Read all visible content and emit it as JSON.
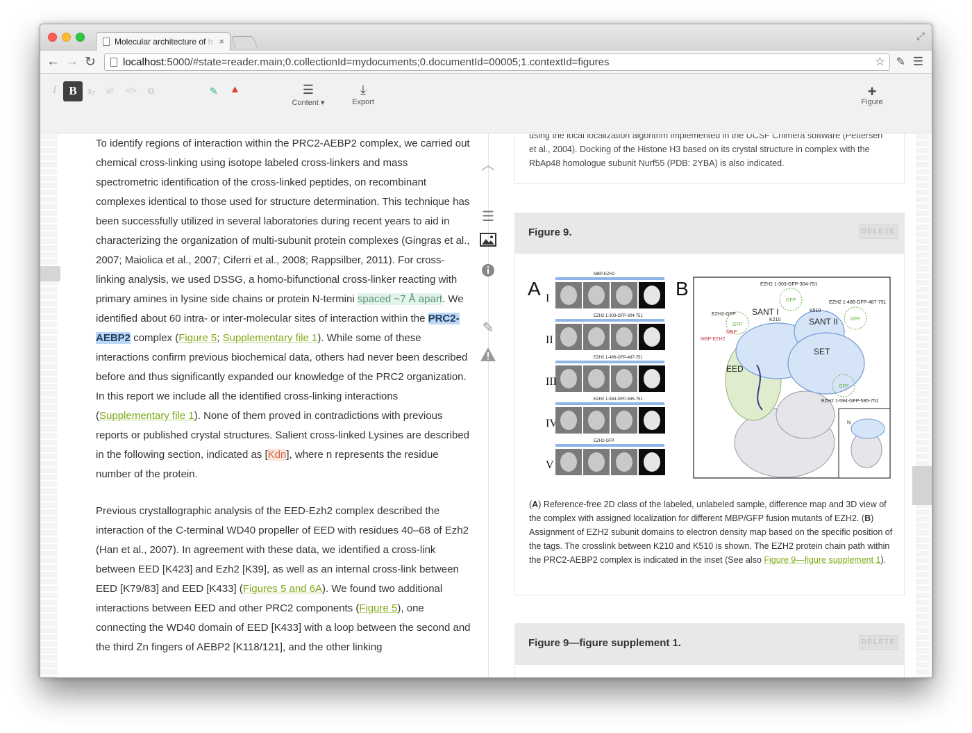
{
  "browser": {
    "tab_title": "Molecular architecture of ",
    "tab_title_fade": "h",
    "tab_close": "×",
    "url_host": "localhost",
    "url_rest": ":5000/#state=reader.main;0.collectionId=mydocuments;0.documentId=00005;1.contextId=figures",
    "icons": [
      "back-icon",
      "forward-icon",
      "reload-icon",
      "page-icon",
      "bookmark-star-icon",
      "wrench-icon",
      "menu-icon"
    ]
  },
  "toolbar": {
    "format_italic": "I",
    "format_bold": "B",
    "format_sub": "x₂",
    "format_sup": "x²",
    "format_code": "</>",
    "format_link": "⧉",
    "content_label": "Content",
    "export_label": "Export",
    "figure_label": "Figure"
  },
  "article": {
    "p1": {
      "t1": "To identify regions of interaction within the PRC2-AEBP2 complex, we carried out chemical cross-linking using isotope labeled cross-linkers and mass spectrometric identification of the cross-linked peptides, on recombinant complexes identical to those used for structure determination. This technique has been successfully utilized in several laboratories during recent years to aid in characterizing the organization of multi-subunit protein complexes (Gingras et al., 2007; Maiolica et al., 2007; Ciferri et al., 2008; Rappsilber, 2011). For cross-linking analysis, we used DSSG, a homo-bifunctional cross-linker reacting with primary amines in lysine side chains or protein N-termini ",
      "hl_spaced": "spaced ~7 Å apart",
      "t2": ". We identified about 60 intra- or inter-molecular sites of interaction within the ",
      "hl_prc": "PRC2-AEBP2",
      "t3": " complex (",
      "link_fig5": "Figure 5",
      "t4": "; ",
      "link_supp1": "Supplementary file 1",
      "t5": "). While some of these interactions confirm previous biochemical data, others had never been described before and thus significantly expanded our knowledge of the PRC2 organization. In this report we include all the identified cross-linking interactions (",
      "link_supp1b": "Supplementary file 1",
      "t6": "). None of them proved in contradictions with previous reports or published crystal structures. Salient cross-linked Lysines are described in the following section, indicated as [",
      "hl_kdn": "Kdn",
      "t7": "], where n represents the residue number of the protein."
    },
    "p2": {
      "t1": "Previous crystallographic analysis of the EED-Ezh2 complex described the interaction of the C-terminal WD40 propeller of EED with residues 40–68 of Ezh2 (Han et al., 2007). In agreement with these data, we identified a cross-link between EED [K423] and Ezh2 [K39], as well as an internal cross-link between EED [K79/83] and EED [K433] (",
      "link_figs": "Figures 5 and 6A",
      "t2": "). We found two additional interactions between EED and other PRC2 components (",
      "link_fig5": "Figure 5",
      "t3": "), one connecting the WD40 domain of EED [K433] with a loop between the second and the third Zn fingers of AEBP2 [K118/121], and the other linking"
    }
  },
  "context_icons": [
    "chevron-up-icon",
    "paragraph-icon",
    "image-icon",
    "info-icon",
    "pencil-icon",
    "warning-icon"
  ],
  "figures": {
    "prev_caption": "using the local localization algorithm implemented in the UCSF Chimera software (Pettersen et al., 2004). Docking of the Histone H3 based on its crystal structure in complex with the RbAp48 homologue subunit Nurf55 (PDB: 2YBA) is also indicated.",
    "fig9": {
      "label": "Figure 9.",
      "delete_label": "DELETE",
      "panel_a": "A",
      "panel_b": "B",
      "rows": [
        {
          "roman": "I",
          "label": "MBP-EZH2",
          "tag": "EZH2"
        },
        {
          "roman": "II",
          "label": "EZH2 1-303-GFP-304-751"
        },
        {
          "roman": "III",
          "label": "EZH2 1-486-GFP-487-751"
        },
        {
          "roman": "IV",
          "label": "EZH2 1-594-GFP-595-751"
        },
        {
          "roman": "V",
          "label": "EZH2-GFP"
        }
      ],
      "map_labels": {
        "top": "EZH2 1-303-GFP-304-751",
        "top_right": "EZH2 1-486-GFP-487-751",
        "bottom_right": "EZH2 1-594-GFP-595-751",
        "ezh2_gfp": "EZH2-GFP",
        "gfp": "GFP",
        "mbp": "MBP",
        "mbp_ezh2": "MBP-EZH2",
        "sant1": "SANT I",
        "k210": "K210",
        "sant2": "SANT II",
        "k510": "K510",
        "set": "SET",
        "eed": "EED",
        "n": "N"
      },
      "caption": {
        "a_open": "(",
        "a": "A",
        "t1": ") Reference-free 2D class of the labeled, unlabeled sample, difference map and 3D view of the complex with assigned localization for different MBP/GFP fusion mutants of EZH2. (",
        "b": "B",
        "t2": ") Assignment of EZH2 subunit domains to electron density map based on the specific position of the tags. The crosslink between K210 and K510 is shown. The EZH2 protein chain path within the PRC2-AEBP2 complex is indicated in the inset (See also ",
        "link": "Figure 9—figure supplement 1",
        "t3": ")."
      }
    },
    "fig9s1": {
      "label": "Figure 9—figure supplement 1.",
      "delete_label": "DELETE"
    }
  },
  "colors": {
    "link": "#7ea815",
    "highlight_prc": "#bcd7f5",
    "highlight_spaced": "#e3f5ea",
    "highlight_kdn": "#fde3dc",
    "density_blue": "#8fb6e6",
    "density_green": "#a9cf8a",
    "gfp": "#5fae3a",
    "mbp": "#c0394b"
  }
}
